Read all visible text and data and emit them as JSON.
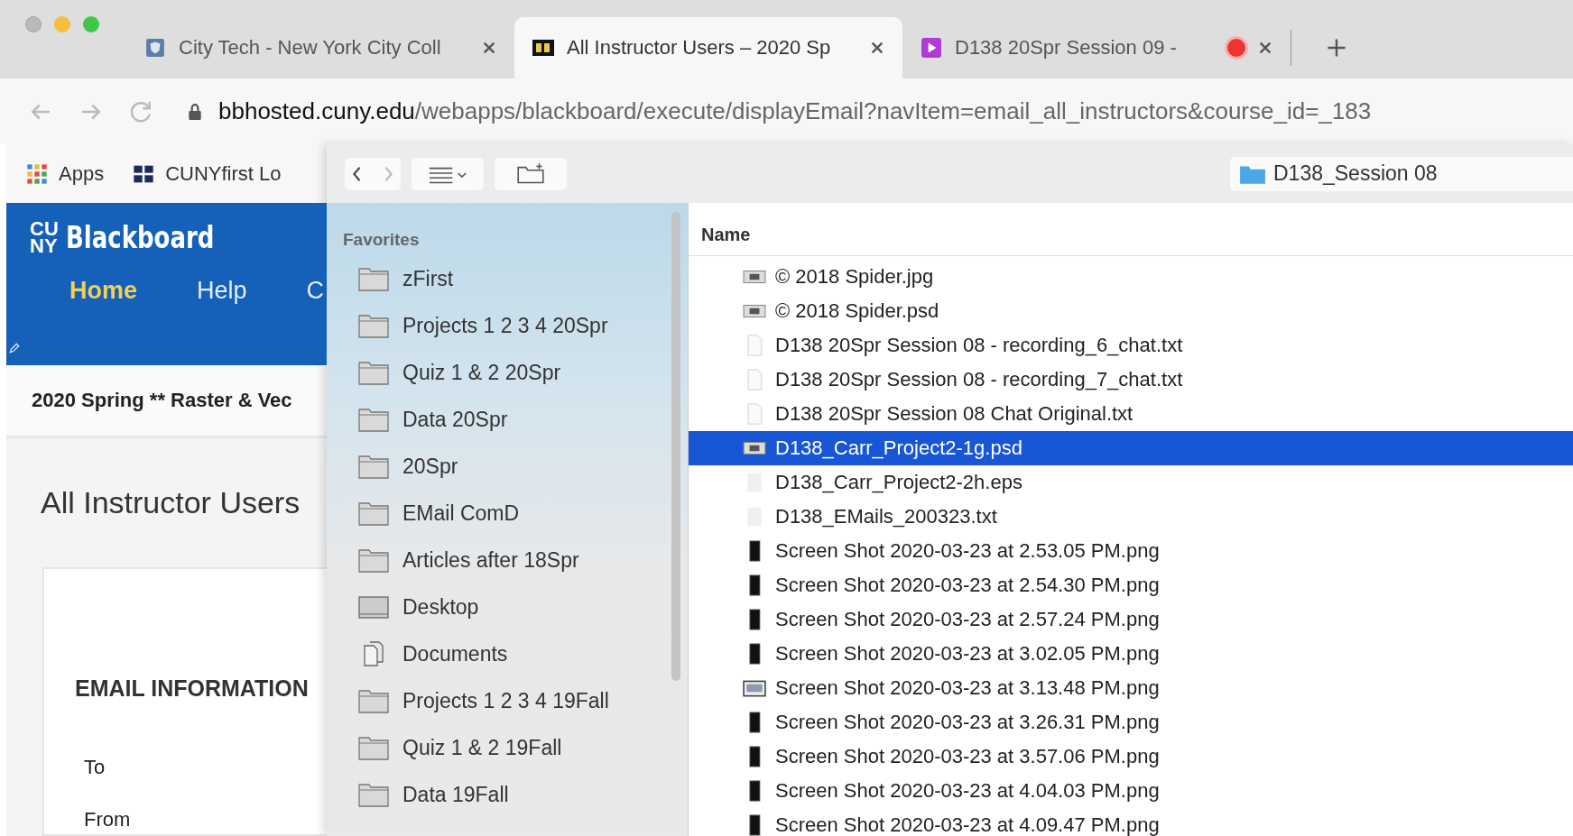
{
  "browser": {
    "tabs": [
      {
        "title": "City Tech - New York City Coll",
        "selected": false,
        "recording": false
      },
      {
        "title": "All Instructor Users – 2020 Sp",
        "selected": true,
        "recording": false
      },
      {
        "title": "D138 20Spr Session 09 -",
        "selected": false,
        "recording": true
      }
    ],
    "url": {
      "host": "bbhosted.cuny.edu",
      "path": "/webapps/blackboard/execute/displayEmail?navItem=email_all_instructors&course_id=_183"
    },
    "bookmarks": [
      "Apps",
      "CUNYfirst Lo"
    ]
  },
  "page": {
    "logo_mark": [
      "CU",
      "NY"
    ],
    "logo": "Blackboard",
    "nav": [
      {
        "label": "Home",
        "selected": true
      },
      {
        "label": "Help",
        "selected": false
      },
      {
        "label": "C",
        "selected": false
      }
    ],
    "course": "2020 Spring ** Raster & Vec",
    "heading": "All Instructor Users",
    "section": "EMAIL INFORMATION",
    "fields": [
      "To",
      "From"
    ]
  },
  "dialog": {
    "path": "D138_Session 08",
    "sidebar": {
      "heading": "Favorites",
      "items": [
        {
          "label": "zFirst",
          "kind": "folder"
        },
        {
          "label": "Projects 1 2 3 4  20Spr",
          "kind": "folder"
        },
        {
          "label": "Quiz 1 & 2  20Spr",
          "kind": "folder"
        },
        {
          "label": "Data 20Spr",
          "kind": "folder"
        },
        {
          "label": "20Spr",
          "kind": "folder"
        },
        {
          "label": "EMail ComD",
          "kind": "folder"
        },
        {
          "label": "Articles after 18Spr",
          "kind": "folder"
        },
        {
          "label": "Desktop",
          "kind": "desktop"
        },
        {
          "label": "Documents",
          "kind": "documents"
        },
        {
          "label": "Projects 1 2 3 4  19Fall",
          "kind": "folder"
        },
        {
          "label": "Quiz 1 & 2  19Fall",
          "kind": "folder"
        },
        {
          "label": "Data 19Fall",
          "kind": "folder"
        }
      ]
    },
    "list": {
      "column": "Name",
      "files": [
        {
          "name": "© 2018 Spider.jpg",
          "kind": "image",
          "selected": false
        },
        {
          "name": "© 2018 Spider.psd",
          "kind": "image",
          "selected": false
        },
        {
          "name": "D138 20Spr Session 08 - recording_6_chat.txt",
          "kind": "text",
          "selected": false
        },
        {
          "name": "D138 20Spr Session 08 - recording_7_chat.txt",
          "kind": "text",
          "selected": false
        },
        {
          "name": "D138 20Spr Session 08 Chat Original.txt",
          "kind": "text",
          "selected": false
        },
        {
          "name": "D138_Carr_Project2-1g.psd",
          "kind": "image",
          "selected": true
        },
        {
          "name": "D138_Carr_Project2-2h.eps",
          "kind": "blank",
          "selected": false
        },
        {
          "name": "D138_EMails_200323.txt",
          "kind": "blank",
          "selected": false
        },
        {
          "name": "Screen Shot 2020-03-23 at 2.53.05 PM.png",
          "kind": "screenshot",
          "selected": false
        },
        {
          "name": "Screen Shot 2020-03-23 at 2.54.30 PM.png",
          "kind": "screenshot",
          "selected": false
        },
        {
          "name": "Screen Shot 2020-03-23 at 2.57.24 PM.png",
          "kind": "screenshot",
          "selected": false
        },
        {
          "name": "Screen Shot 2020-03-23 at 3.02.05 PM.png",
          "kind": "screenshot",
          "selected": false
        },
        {
          "name": "Screen Shot 2020-03-23 at 3.13.48 PM.png",
          "kind": "window",
          "selected": false
        },
        {
          "name": "Screen Shot 2020-03-23 at 3.26.31 PM.png",
          "kind": "screenshot",
          "selected": false
        },
        {
          "name": "Screen Shot 2020-03-23 at 3.57.06 PM.png",
          "kind": "screenshot",
          "selected": false
        },
        {
          "name": "Screen Shot 2020-03-23 at 4.04.03 PM.png",
          "kind": "screenshot",
          "selected": false
        },
        {
          "name": "Screen Shot 2020-03-23 at 4.09.47 PM.png",
          "kind": "screenshot",
          "selected": false
        }
      ]
    }
  }
}
